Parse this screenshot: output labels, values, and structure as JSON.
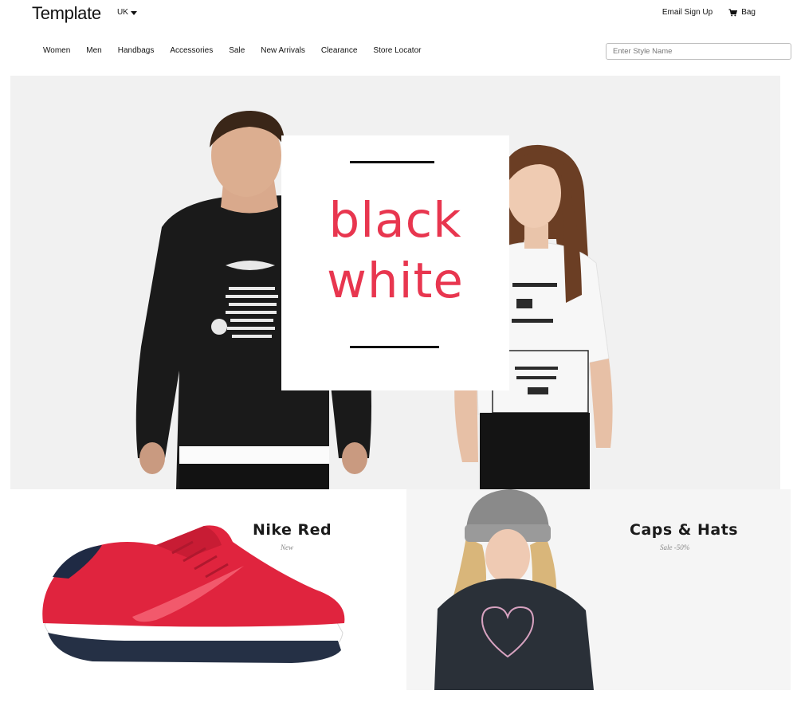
{
  "header": {
    "brand": "Template",
    "region": "UK",
    "email_signup": "Email Sign Up",
    "bag": "Bag"
  },
  "nav": {
    "items": [
      "Women",
      "Men",
      "Handbags",
      "Accessories",
      "Sale",
      "New Arrivals",
      "Clearance",
      "Store Locator"
    ]
  },
  "search": {
    "placeholder": "Enter Style Name",
    "value": ""
  },
  "hero": {
    "line1": "black",
    "line2": "white",
    "accent_color": "#e8364f"
  },
  "promos": [
    {
      "title": "Nike Red",
      "subtitle": "New",
      "product_color": "#e0243e"
    },
    {
      "title": "Caps & Hats",
      "subtitle": "Sale -50%",
      "product_color": "#2a3038"
    }
  ],
  "icons": {
    "region_caret": "chevron-down-icon",
    "bag": "shopping-cart-icon"
  }
}
